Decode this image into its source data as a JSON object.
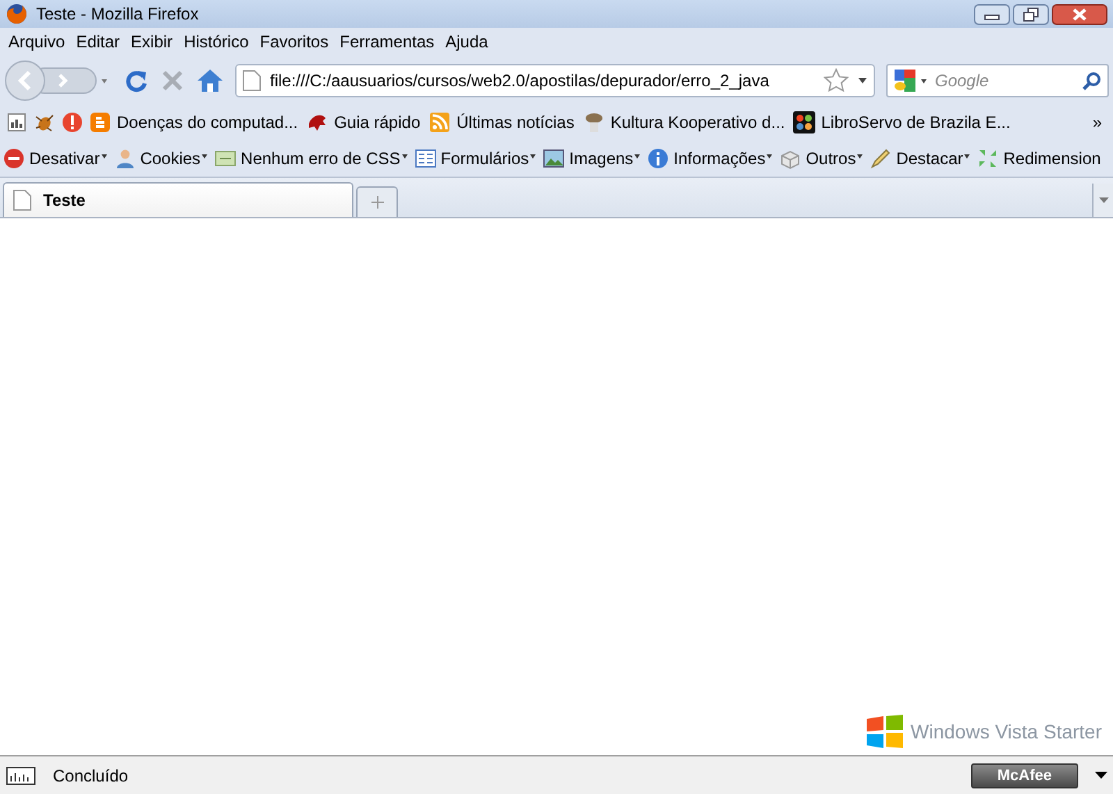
{
  "window": {
    "title": "Teste - Mozilla Firefox"
  },
  "menu": [
    "Arquivo",
    "Editar",
    "Exibir",
    "Histórico",
    "Favoritos",
    "Ferramentas",
    "Ajuda"
  ],
  "address": {
    "value": "file:///C:/aausuarios/cursos/web2.0/apostilas/depurador/erro_2_java"
  },
  "search": {
    "placeholder": "Google"
  },
  "bookmarks": {
    "items": [
      {
        "label": "Doenças do computad..."
      },
      {
        "label": "Guia rápido"
      },
      {
        "label": "Últimas notícias"
      },
      {
        "label": "Kultura Kooperativo d..."
      },
      {
        "label": "LibroServo de Brazila E..."
      }
    ],
    "overflow": "»"
  },
  "developer_toolbar": [
    {
      "label": "Desativar",
      "dropdown": true
    },
    {
      "label": "Cookies",
      "dropdown": true
    },
    {
      "label": "Nenhum erro de CSS",
      "dropdown": true
    },
    {
      "label": "Formulários",
      "dropdown": true
    },
    {
      "label": "Imagens",
      "dropdown": true
    },
    {
      "label": "Informações",
      "dropdown": true
    },
    {
      "label": "Outros",
      "dropdown": true
    },
    {
      "label": "Destacar",
      "dropdown": true
    },
    {
      "label": "Redimension",
      "dropdown": false
    }
  ],
  "tabs": [
    {
      "label": "Teste",
      "selected": true
    }
  ],
  "watermark": "Windows Vista Starter",
  "status_bar": {
    "text": "Concluído",
    "badge": "McAfee"
  }
}
